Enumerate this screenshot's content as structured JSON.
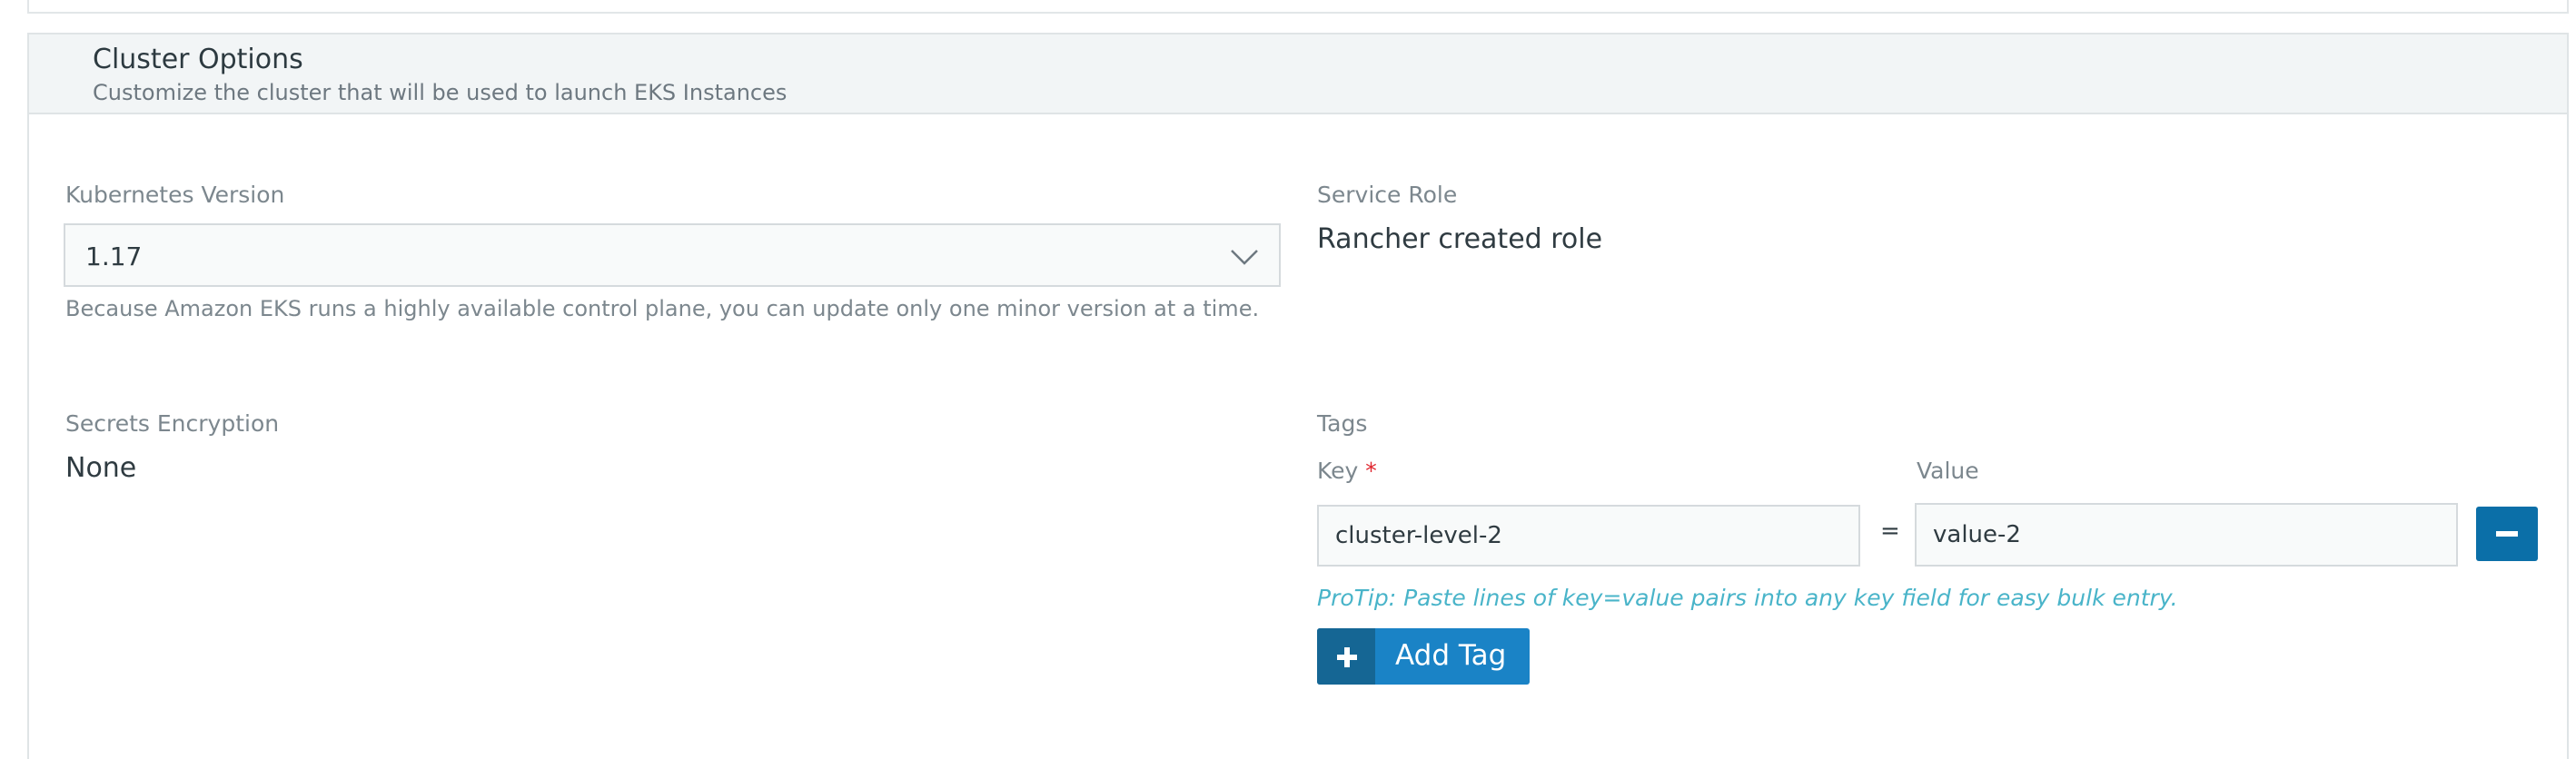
{
  "section": {
    "title": "Cluster Options",
    "subtitle": "Customize the cluster that will be used to launch EKS Instances"
  },
  "kubernetes_version": {
    "label": "Kubernetes Version",
    "selected": "1.17",
    "help": "Because Amazon EKS runs a highly available control plane, you can update only one minor version at a time."
  },
  "service_role": {
    "label": "Service Role",
    "value": "Rancher created role"
  },
  "secrets_encryption": {
    "label": "Secrets Encryption",
    "value": "None"
  },
  "tags": {
    "label": "Tags",
    "key_label": "Key",
    "required_marker": "*",
    "value_label": "Value",
    "rows": [
      {
        "key": "cluster-level-2",
        "separator": "=",
        "value": "value-2"
      }
    ],
    "protip": "ProTip: Paste lines of key=value pairs into any key field for easy bulk entry.",
    "add_label": "Add Tag"
  },
  "icons": {
    "select_chevron": "chevron-down-icon",
    "remove": "minus-icon",
    "add": "plus-icon"
  },
  "colors": {
    "primary_button": "#1a83c6",
    "primary_button_dark": "#156694",
    "remove_button": "#0b6fa8",
    "protip": "#49b4c9",
    "required": "#e0262f"
  }
}
